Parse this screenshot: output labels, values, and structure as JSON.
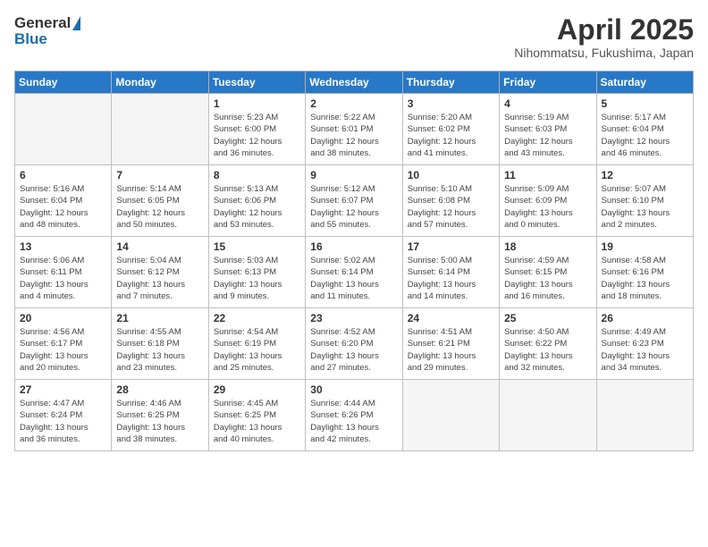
{
  "logo": {
    "line1": "General",
    "line2": "Blue"
  },
  "title": "April 2025",
  "subtitle": "Nihommatsu, Fukushima, Japan",
  "days_of_week": [
    "Sunday",
    "Monday",
    "Tuesday",
    "Wednesday",
    "Thursday",
    "Friday",
    "Saturday"
  ],
  "weeks": [
    [
      {
        "day": "",
        "info": ""
      },
      {
        "day": "",
        "info": ""
      },
      {
        "day": "1",
        "info": "Sunrise: 5:23 AM\nSunset: 6:00 PM\nDaylight: 12 hours\nand 36 minutes."
      },
      {
        "day": "2",
        "info": "Sunrise: 5:22 AM\nSunset: 6:01 PM\nDaylight: 12 hours\nand 38 minutes."
      },
      {
        "day": "3",
        "info": "Sunrise: 5:20 AM\nSunset: 6:02 PM\nDaylight: 12 hours\nand 41 minutes."
      },
      {
        "day": "4",
        "info": "Sunrise: 5:19 AM\nSunset: 6:03 PM\nDaylight: 12 hours\nand 43 minutes."
      },
      {
        "day": "5",
        "info": "Sunrise: 5:17 AM\nSunset: 6:04 PM\nDaylight: 12 hours\nand 46 minutes."
      }
    ],
    [
      {
        "day": "6",
        "info": "Sunrise: 5:16 AM\nSunset: 6:04 PM\nDaylight: 12 hours\nand 48 minutes."
      },
      {
        "day": "7",
        "info": "Sunrise: 5:14 AM\nSunset: 6:05 PM\nDaylight: 12 hours\nand 50 minutes."
      },
      {
        "day": "8",
        "info": "Sunrise: 5:13 AM\nSunset: 6:06 PM\nDaylight: 12 hours\nand 53 minutes."
      },
      {
        "day": "9",
        "info": "Sunrise: 5:12 AM\nSunset: 6:07 PM\nDaylight: 12 hours\nand 55 minutes."
      },
      {
        "day": "10",
        "info": "Sunrise: 5:10 AM\nSunset: 6:08 PM\nDaylight: 12 hours\nand 57 minutes."
      },
      {
        "day": "11",
        "info": "Sunrise: 5:09 AM\nSunset: 6:09 PM\nDaylight: 13 hours\nand 0 minutes."
      },
      {
        "day": "12",
        "info": "Sunrise: 5:07 AM\nSunset: 6:10 PM\nDaylight: 13 hours\nand 2 minutes."
      }
    ],
    [
      {
        "day": "13",
        "info": "Sunrise: 5:06 AM\nSunset: 6:11 PM\nDaylight: 13 hours\nand 4 minutes."
      },
      {
        "day": "14",
        "info": "Sunrise: 5:04 AM\nSunset: 6:12 PM\nDaylight: 13 hours\nand 7 minutes."
      },
      {
        "day": "15",
        "info": "Sunrise: 5:03 AM\nSunset: 6:13 PM\nDaylight: 13 hours\nand 9 minutes."
      },
      {
        "day": "16",
        "info": "Sunrise: 5:02 AM\nSunset: 6:14 PM\nDaylight: 13 hours\nand 11 minutes."
      },
      {
        "day": "17",
        "info": "Sunrise: 5:00 AM\nSunset: 6:14 PM\nDaylight: 13 hours\nand 14 minutes."
      },
      {
        "day": "18",
        "info": "Sunrise: 4:59 AM\nSunset: 6:15 PM\nDaylight: 13 hours\nand 16 minutes."
      },
      {
        "day": "19",
        "info": "Sunrise: 4:58 AM\nSunset: 6:16 PM\nDaylight: 13 hours\nand 18 minutes."
      }
    ],
    [
      {
        "day": "20",
        "info": "Sunrise: 4:56 AM\nSunset: 6:17 PM\nDaylight: 13 hours\nand 20 minutes."
      },
      {
        "day": "21",
        "info": "Sunrise: 4:55 AM\nSunset: 6:18 PM\nDaylight: 13 hours\nand 23 minutes."
      },
      {
        "day": "22",
        "info": "Sunrise: 4:54 AM\nSunset: 6:19 PM\nDaylight: 13 hours\nand 25 minutes."
      },
      {
        "day": "23",
        "info": "Sunrise: 4:52 AM\nSunset: 6:20 PM\nDaylight: 13 hours\nand 27 minutes."
      },
      {
        "day": "24",
        "info": "Sunrise: 4:51 AM\nSunset: 6:21 PM\nDaylight: 13 hours\nand 29 minutes."
      },
      {
        "day": "25",
        "info": "Sunrise: 4:50 AM\nSunset: 6:22 PM\nDaylight: 13 hours\nand 32 minutes."
      },
      {
        "day": "26",
        "info": "Sunrise: 4:49 AM\nSunset: 6:23 PM\nDaylight: 13 hours\nand 34 minutes."
      }
    ],
    [
      {
        "day": "27",
        "info": "Sunrise: 4:47 AM\nSunset: 6:24 PM\nDaylight: 13 hours\nand 36 minutes."
      },
      {
        "day": "28",
        "info": "Sunrise: 4:46 AM\nSunset: 6:25 PM\nDaylight: 13 hours\nand 38 minutes."
      },
      {
        "day": "29",
        "info": "Sunrise: 4:45 AM\nSunset: 6:25 PM\nDaylight: 13 hours\nand 40 minutes."
      },
      {
        "day": "30",
        "info": "Sunrise: 4:44 AM\nSunset: 6:26 PM\nDaylight: 13 hours\nand 42 minutes."
      },
      {
        "day": "",
        "info": ""
      },
      {
        "day": "",
        "info": ""
      },
      {
        "day": "",
        "info": ""
      }
    ]
  ]
}
